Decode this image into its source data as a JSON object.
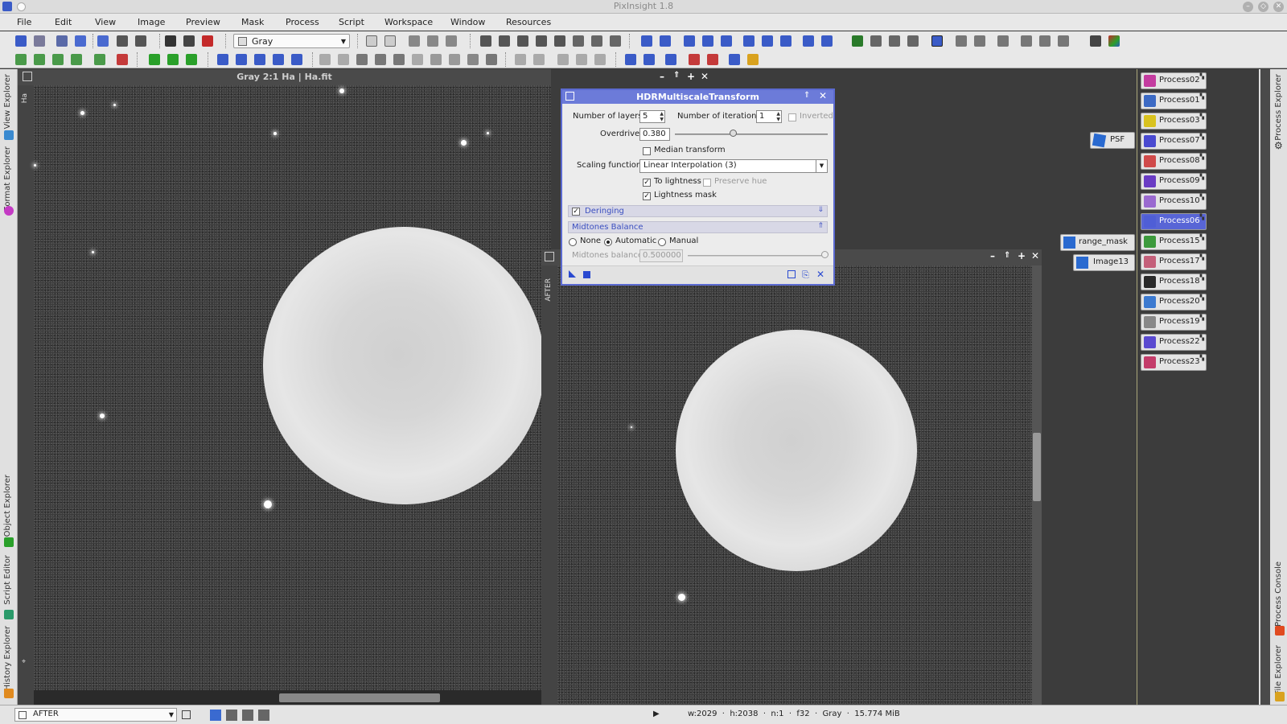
{
  "window": {
    "title": "PixInsight 1.8"
  },
  "menu": [
    "File",
    "Edit",
    "View",
    "Image",
    "Preview",
    "Mask",
    "Process",
    "Script",
    "Workspace",
    "Window",
    "Resources"
  ],
  "toolbar": {
    "color_space": "Gray"
  },
  "left_tabs": [
    "View Explorer",
    "Format Explorer",
    "Object Explorer",
    "Script Editor",
    "History Explorer"
  ],
  "right_tabs": [
    "Process Explorer",
    "Process Console",
    "File Explorer"
  ],
  "image_window_1": {
    "title": "Gray 2:1 Ha | Ha.fit",
    "side_label": "Ha"
  },
  "image_window_2": {
    "side_label": "AFTER"
  },
  "dialog": {
    "title": "HDRMultiscaleTransform",
    "num_layers_label": "Number of layers:",
    "num_layers": "5",
    "num_iterations_label": "Number of iterations:",
    "num_iterations": "1",
    "inverted_label": "Inverted",
    "overdrive_label": "Overdrive:",
    "overdrive": "0.380",
    "overdrive_fraction": 0.38,
    "median_transform_label": "Median transform",
    "scaling_function_label": "Scaling function:",
    "scaling_function": "Linear Interpolation (3)",
    "to_lightness_label": "To lightness",
    "preserve_hue_label": "Preserve hue",
    "lightness_mask_label": "Lightness mask",
    "deringing_label": "Deringing",
    "midtones_balance_section": "Midtones Balance",
    "radio_none": "None",
    "radio_automatic": "Automatic",
    "radio_manual": "Manual",
    "midtones_balance_label": "Midtones balance:",
    "midtones_balance": "0.500000"
  },
  "desktop_icons": [
    "PSF",
    "range_mask",
    "Image13"
  ],
  "process_icons": [
    {
      "label": "Process02",
      "color": "#c43ca0"
    },
    {
      "label": "Process01",
      "color": "#3c6ac4"
    },
    {
      "label": "Process03",
      "color": "#d9c21f"
    },
    {
      "label": "Process07",
      "color": "#4a4ad0"
    },
    {
      "label": "Process08",
      "color": "#d04a4a"
    },
    {
      "label": "Process09",
      "color": "#6a3cc4"
    },
    {
      "label": "Process10",
      "color": "#9a6ad0"
    },
    {
      "label": "Process06",
      "color": "#4f5ed6"
    },
    {
      "label": "Process15",
      "color": "#3c9a3c"
    },
    {
      "label": "Process17",
      "color": "#c4607a"
    },
    {
      "label": "Process18",
      "color": "#2a2a2a"
    },
    {
      "label": "Process20",
      "color": "#3c7ad0"
    },
    {
      "label": "Process19",
      "color": "#888888"
    },
    {
      "label": "Process22",
      "color": "#5a4ad0"
    },
    {
      "label": "Process23",
      "color": "#c43c6a"
    }
  ],
  "statusbar": {
    "view_selector": "AFTER",
    "info": "w:2029  ·  h:2038  ·  n:1  ·  f32  ·  Gray  ·  15.774 MiB"
  }
}
